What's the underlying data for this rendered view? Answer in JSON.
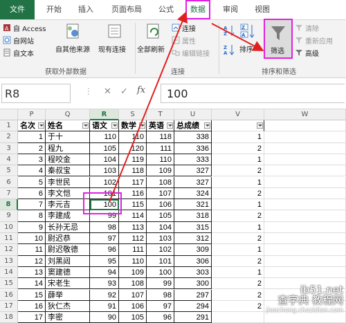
{
  "ribbon_tabs": [
    "文件",
    "开始",
    "插入",
    "页面布局",
    "公式",
    "数据",
    "审阅",
    "视图"
  ],
  "ribbon": {
    "access": "自 Access",
    "web": "自网站",
    "text": "自文本",
    "other_sources": "自其他来源",
    "existing": "现有连接",
    "refresh_all": "全部刷新",
    "connections": "连接",
    "properties": "属性",
    "edit_links": "编辑链接",
    "sort": "排序",
    "filter": "筛选",
    "clear": "清除",
    "reapply": "重新应用",
    "advanced": "高级",
    "group_external": "获取外部数据",
    "group_connections": "连接",
    "group_sort_filter": "排序和筛选"
  },
  "formula_bar": {
    "name_box": "R8",
    "fx": "fx",
    "value": "100"
  },
  "columns": [
    "P",
    "Q",
    "R",
    "S",
    "T",
    "U",
    "V",
    "W"
  ],
  "active_column": "R",
  "active_row": 8,
  "headers": [
    "名次",
    "姓名",
    "语文",
    "数学",
    "英语",
    "总成绩",
    "",
    ""
  ],
  "rows": [
    {
      "r": "2",
      "p": "1",
      "q": "于十",
      "r_": "110",
      "s": "110",
      "t": "118",
      "u": "338",
      "v": "1"
    },
    {
      "r": "3",
      "p": "2",
      "q": "程九",
      "r_": "105",
      "s": "120",
      "t": "111",
      "u": "336",
      "v": "2"
    },
    {
      "r": "4",
      "p": "3",
      "q": "程咬金",
      "r_": "104",
      "s": "119",
      "t": "110",
      "u": "333",
      "v": "1"
    },
    {
      "r": "5",
      "p": "4",
      "q": "秦叔宝",
      "r_": "103",
      "s": "118",
      "t": "109",
      "u": "327",
      "v": "2"
    },
    {
      "r": "6",
      "p": "5",
      "q": "李世民",
      "r_": "102",
      "s": "117",
      "t": "108",
      "u": "327",
      "v": "1"
    },
    {
      "r": "7",
      "p": "6",
      "q": "李文恺",
      "r_": "101",
      "s": "116",
      "t": "107",
      "u": "324",
      "v": "2"
    },
    {
      "r": "8",
      "p": "7",
      "q": "李元吉",
      "r_": "100",
      "s": "115",
      "t": "106",
      "u": "321",
      "v": "1"
    },
    {
      "r": "9",
      "p": "8",
      "q": "李建成",
      "r_": "99",
      "s": "114",
      "t": "105",
      "u": "318",
      "v": "2"
    },
    {
      "r": "10",
      "p": "9",
      "q": "长孙无忌",
      "r_": "98",
      "s": "113",
      "t": "104",
      "u": "315",
      "v": "1"
    },
    {
      "r": "11",
      "p": "10",
      "q": "尉迟恭",
      "r_": "97",
      "s": "112",
      "t": "103",
      "u": "312",
      "v": "2"
    },
    {
      "r": "12",
      "p": "11",
      "q": "尉迟敬德",
      "r_": "96",
      "s": "111",
      "t": "102",
      "u": "309",
      "v": "1"
    },
    {
      "r": "13",
      "p": "12",
      "q": "刘黑闼",
      "r_": "95",
      "s": "110",
      "t": "101",
      "u": "306",
      "v": "2"
    },
    {
      "r": "14",
      "p": "13",
      "q": "窦建德",
      "r_": "94",
      "s": "109",
      "t": "100",
      "u": "303",
      "v": "1"
    },
    {
      "r": "15",
      "p": "14",
      "q": "宋老生",
      "r_": "93",
      "s": "108",
      "t": "99",
      "u": "300",
      "v": "2"
    },
    {
      "r": "16",
      "p": "15",
      "q": "薛举",
      "r_": "92",
      "s": "107",
      "t": "98",
      "u": "297",
      "v": "2"
    },
    {
      "r": "17",
      "p": "16",
      "q": "狄仁杰",
      "r_": "91",
      "s": "106",
      "t": "97",
      "u": "294",
      "v": "2"
    },
    {
      "r": "18",
      "p": "17",
      "q": "李密",
      "r_": "90",
      "s": "105",
      "t": "96",
      "u": "291",
      "v": ""
    }
  ],
  "watermark": {
    "line1": "ib51.net",
    "line2": "查字典 教程网",
    "url": "jiaocheng.chazidian.com"
  },
  "colors": {
    "accent": "#217346",
    "highlight": "#e020e0",
    "arrow": "#e02020"
  },
  "icons": [
    "access-icon",
    "web-icon",
    "text-icon",
    "other-sources-icon",
    "existing-connections-icon",
    "refresh-icon",
    "connections-icon",
    "properties-icon",
    "edit-links-icon",
    "sort-az-icon",
    "sort-za-icon",
    "sort-icon",
    "filter-funnel-icon",
    "clear-icon",
    "reapply-icon",
    "advanced-icon",
    "fx-icon",
    "dropdown-icon"
  ]
}
